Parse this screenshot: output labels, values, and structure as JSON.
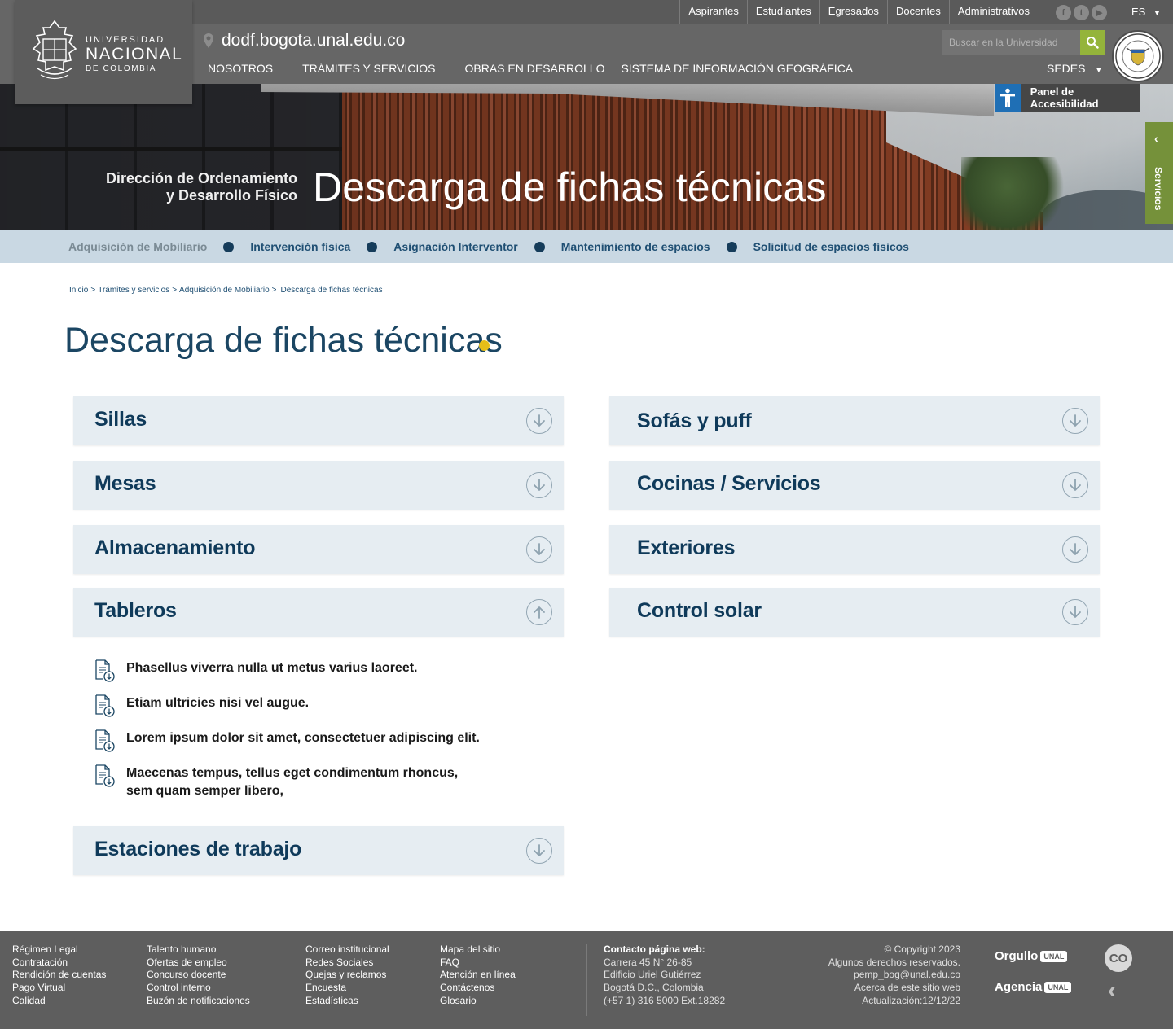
{
  "header": {
    "logo": {
      "line1": "UNIVERSIDAD",
      "line2": "NACIONAL",
      "line3": "DE COLOMBIA"
    },
    "top_links": [
      "Aspirantes",
      "Estudiantes",
      "Egresados",
      "Docentes",
      "Administrativos"
    ],
    "social_icons": [
      "facebook-icon",
      "twitter-icon",
      "youtube-icon"
    ],
    "language": "ES",
    "domain": "dodf.bogota.unal.edu.co",
    "search_placeholder": "Buscar en la Universidad",
    "main_nav": [
      "NOSOTROS",
      "TRÁMITES Y SERVICIOS",
      "OBRAS EN DESARROLLO",
      "SISTEMA DE INFORMACIÓN GEOGRÁFICA"
    ],
    "sedes": "SEDES",
    "accent_color": "#94b43b"
  },
  "banner": {
    "dependency_line1": "Dirección de Ordenamiento",
    "dependency_line2": "y Desarrollo Físico",
    "title": "Descarga de fichas técnicas",
    "accessibility": "Panel de Accesibilidad",
    "services_tab": "Servicios"
  },
  "subnav": {
    "items": [
      "Adquisición de Mobiliario",
      "Intervención física",
      "Asignación Interventor",
      "Mantenimiento de espacios",
      "Solicitud de espacios físicos"
    ]
  },
  "breadcrumb": [
    "Inicio",
    "Trámites y servicios",
    "Adquisición de Mobiliario",
    "Descarga de fichas técnicas"
  ],
  "page_title": "Descarga de fichas técnicas",
  "accordions": {
    "left": [
      "Sillas",
      "Mesas",
      "Almacenamiento",
      "Tableros",
      "Estaciones de trabajo"
    ],
    "right": [
      "Sofás y puff",
      "Cocinas / Servicios",
      "Exteriores",
      "Control solar"
    ],
    "expanded": "Tableros"
  },
  "files": [
    {
      "line1": "Phasellus viverra nulla ut metus varius laoreet.",
      "line2": ""
    },
    {
      "line1": "Etiam ultricies nisi vel augue.",
      "line2": ""
    },
    {
      "line1": "Lorem ipsum dolor sit amet, consectetuer adipiscing elit.",
      "line2": ""
    },
    {
      "line1": "Maecenas tempus, tellus eget condimentum rhoncus,",
      "line2": "sem quam semper libero,"
    }
  ],
  "footer": {
    "col1": [
      "Régimen Legal",
      "Contratación",
      "Rendición de cuentas",
      "Pago Virtual",
      "Calidad"
    ],
    "col2": [
      "Talento humano",
      "Ofertas de empleo",
      "Concurso docente",
      "Control interno",
      "Buzón de notificaciones"
    ],
    "col3": [
      "Correo institucional",
      "Redes Sociales",
      "Quejas y reclamos",
      "Encuesta",
      "Estadísticas"
    ],
    "col4": [
      "Mapa del sitio",
      "FAQ",
      "Atención en línea",
      "Contáctenos",
      "Glosario"
    ],
    "contact": [
      "Contacto página web:",
      "Carrera 45 N° 26-85",
      "Edificio Uriel Gutiérrez",
      "Bogotá D.C., Colombia",
      "(+57 1) 316 5000 Ext.18282"
    ],
    "copyright": [
      "© Copyright 2023",
      "Algunos derechos reservados.",
      "pemp_bog@unal.edu.co",
      "Acerca de este sitio web",
      "Actualización:12/12/22"
    ],
    "brand1": "Orgullo",
    "brand1_tag": "UNAL",
    "brand2": "Agencia",
    "brand2_tag": "UNAL",
    "co_badge": "CO"
  }
}
